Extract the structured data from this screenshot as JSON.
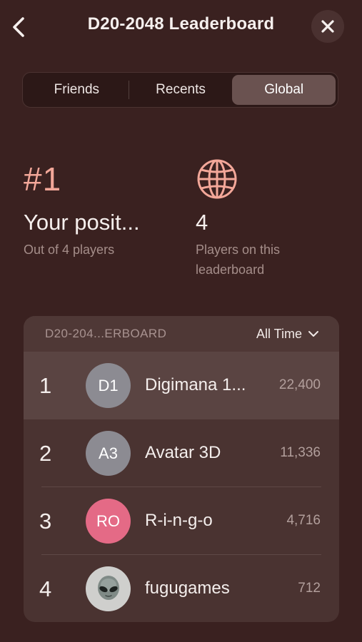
{
  "header": {
    "title": "D20-2048 Leaderboard",
    "back_icon": "chevron-left-icon",
    "close_icon": "close-icon"
  },
  "tabs": [
    {
      "label": "Friends",
      "active": false
    },
    {
      "label": "Recents",
      "active": false
    },
    {
      "label": "Global",
      "active": true
    }
  ],
  "stats": {
    "position": {
      "value": "#1",
      "label": "Your posit...",
      "sub": "Out of 4 players"
    },
    "players": {
      "icon": "globe-icon",
      "value": "4",
      "sub_line1": "Players on this",
      "sub_line2": "leaderboard"
    }
  },
  "board": {
    "label": "D20-204...ERBOARD",
    "filter": "All Time",
    "filter_icon": "chevron-down-icon",
    "rows": [
      {
        "rank": "1",
        "initials": "D1",
        "name": "Digimana 1...",
        "score": "22,400",
        "avatar_color": "#8c8b92"
      },
      {
        "rank": "2",
        "initials": "A3",
        "name": "Avatar 3D",
        "score": "11,336",
        "avatar_color": "#8c8b92"
      },
      {
        "rank": "3",
        "initials": "RO",
        "name": "R-i-n-g-o",
        "score": "4,716",
        "avatar_color": "#e46a86"
      },
      {
        "rank": "4",
        "initials": "",
        "name": "fugugames",
        "score": "712",
        "avatar_color": "#cfcfcd",
        "avatar_icon": "alien-icon"
      }
    ]
  },
  "colors": {
    "background": "#3a2120",
    "accent": "#f3a799",
    "card": "#4a3331"
  }
}
